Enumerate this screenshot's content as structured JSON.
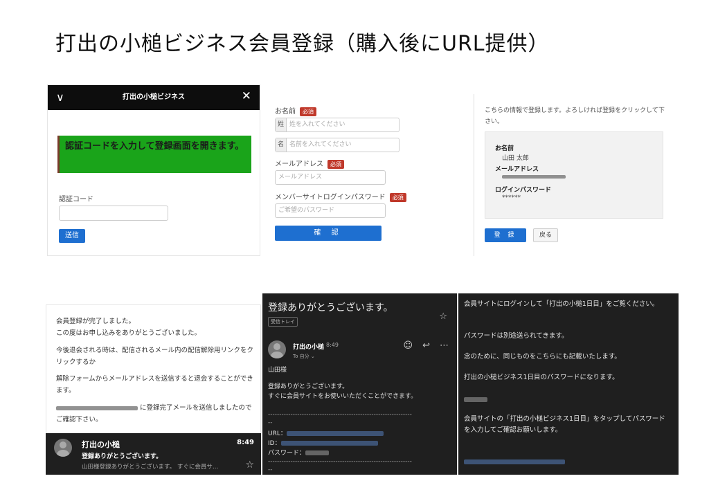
{
  "title": "打出の小槌ビジネス会員登録（購入後にURL提供）",
  "panel1": {
    "bar_title": "打出の小槌ビジネス",
    "banner": "認証コードを入力して登録画面を開きます。",
    "code_label": "認証コード",
    "submit_label": "送信"
  },
  "panel2": {
    "name_label": "お名前",
    "required": "必須",
    "last_prefix": "姓",
    "last_placeholder": "姓を入れてください",
    "first_prefix": "名",
    "first_placeholder": "名前を入れてください",
    "email_label": "メールアドレス",
    "email_placeholder": "メールアドレス",
    "password_label": "メンバーサイトログインパスワード",
    "password_placeholder": "ご希望のパスワード",
    "confirm_label": "確 認"
  },
  "panel3": {
    "intro": "こちらの情報で登録します。よろしければ登録をクリックして下さい。",
    "name_key": "お名前",
    "name_value": "山田 太郎",
    "email_key": "メールアドレス",
    "password_key": "ログインパスワード",
    "password_value": "******",
    "register_label": "登 録",
    "back_label": "戻る"
  },
  "panel4": {
    "line1": "会員登録が完了しました。",
    "line2": "この度はお申し込みをありがとうございました。",
    "line3": "今後退会される時は、配信されるメール内の配信解除用リンクをクリックするか",
    "line4": "解除フォームからメールアドレスを送信すると退会することができます。",
    "line5": "に登録完了メールを送信しましたのでご確認下さい。",
    "sender": "打出の小槌",
    "time": "8:49",
    "subject": "登録ありがとうございます。",
    "preview": "山田様登録ありがとうございます。 すぐに会員サ…"
  },
  "panel5": {
    "subject": "登録ありがとうございます。",
    "inbox_label": "受信トレイ",
    "sender": "打出の小槌",
    "time": "8:49",
    "to": "To 自分",
    "greeting": "山田様",
    "body1": "登録ありがとうございます。",
    "body2": "すぐに会員サイトをお使いいただくことができます。",
    "url_label": "URL：",
    "id_label": "ID：",
    "pw_label": "パスワード："
  },
  "panel6": {
    "p1": "会員サイトにログインして「打出の小槌1日目」をご覧ください。",
    "p2": "パスワードは別途送られてきます。",
    "p3": "念のために、同じものをこちらにも記載いたします。",
    "p4": "打出の小槌ビジネス1日目のパスワードになります。",
    "p5": "会員サイトの「打出の小槌ビジネス1日目」をタップしてパスワードを入力してご確認お願いします。"
  }
}
